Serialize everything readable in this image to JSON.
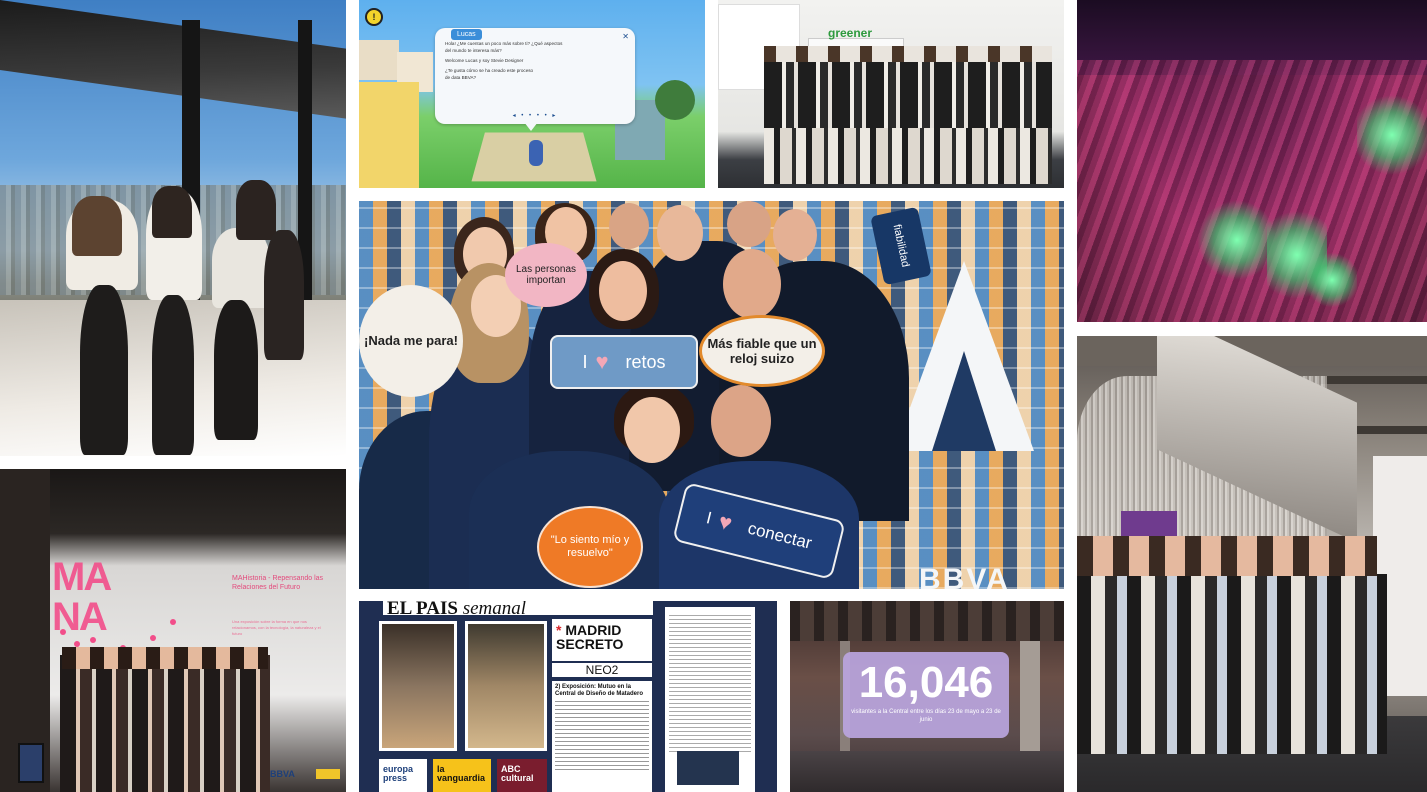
{
  "game": {
    "character_name": "Lucas",
    "bubble_lines": [
      "Hola! ¿Me cuentas un poco más sobre ti? ¿Qué aspectos",
      "del mundo te interesa más?",
      "Welcome Lucas y soy Stevie Designer",
      "¿Te gusta cómo se ha creado este proceso",
      "de data BBVA?"
    ],
    "close_label": "✕",
    "pager": "◂ • • • • ▸"
  },
  "greener": {
    "sign": "greener"
  },
  "group": {
    "sign_nada": "¡Nada me para!",
    "sign_personas": "Las personas importan",
    "sign_retos": "retos",
    "sign_fiable": "Más fiable que un reloj suizo",
    "sign_siento": "\"Lo siento mío y resuelvo\"",
    "sign_conectar": "conectar",
    "sign_fiabilidad": "fiabilidad",
    "sign_i": "I",
    "heart": "♥",
    "brand": "BBVA"
  },
  "pink": {
    "big_title": "MA\nNA",
    "heading": "MAHistoria - Repensando las Relaciones del Futuro",
    "body": "Una exposición sobre la forma en que nos relacionamos, con la tecnología, la naturaleza y el futuro",
    "brand": "BBVA"
  },
  "pais": {
    "masthead": "EL PAÍS",
    "masthead_italic": "semanal",
    "madrid_line1": "MADRID",
    "madrid_line2": "SECRETO",
    "asterisk": "*",
    "neo": "NEO2",
    "article_title": "2) Exposición: Mutuo en la Central de Diseño de Matadero",
    "brands": [
      "europa press",
      "la vanguardia",
      "ABC cultural"
    ]
  },
  "count": {
    "number": "16,046",
    "caption": "visitantes a la Central entre los días 23 de mayo a 23 de junio"
  },
  "colors": {
    "bbva_blue": "#1f3f7a",
    "orange": "#ef7a26",
    "pink": "#f24e8a",
    "lavender": "#baa5de"
  }
}
